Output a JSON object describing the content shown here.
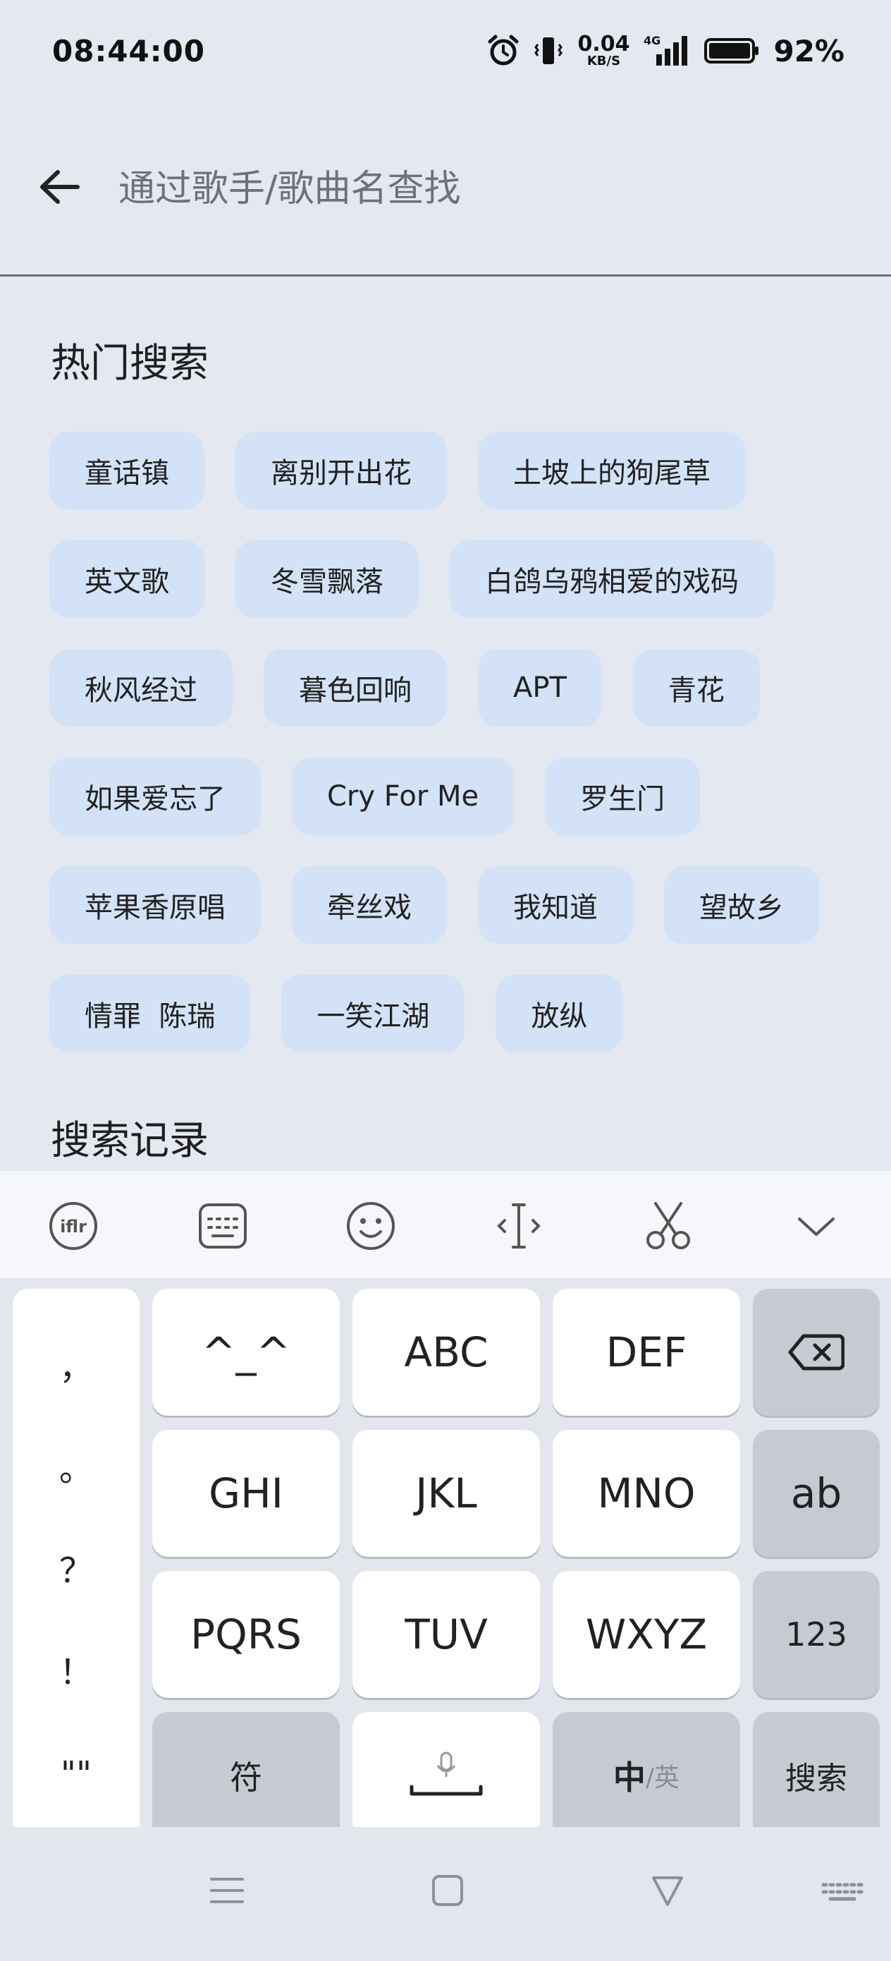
{
  "status_bar": {
    "time": "08:44:00",
    "net_speed_value": "0.04",
    "net_speed_unit": "KB/S",
    "network": "4G",
    "battery": "92%",
    "icons": [
      "alarm-icon",
      "vibrate-icon",
      "signal-icon",
      "battery-icon"
    ]
  },
  "search": {
    "placeholder": "通过歌手/歌曲名查找",
    "value": ""
  },
  "hot_search": {
    "title": "热门搜索",
    "items": [
      "童话镇",
      "离别开出花",
      "土坡上的狗尾草",
      "英文歌",
      "冬雪飘落",
      "白鸽乌鸦相爱的戏码",
      "秋风经过",
      "暮色回响",
      "APT",
      "青花",
      "如果爱忘了",
      "Cry For Me",
      "罗生门",
      "苹果香原唱",
      "牵丝戏",
      "我知道",
      "望故乡",
      "情罪  陈瑞",
      "一笑江湖",
      "放纵"
    ]
  },
  "search_history": {
    "title": "搜索记录"
  },
  "keyboard": {
    "toolbar_icons": [
      "ime-logo-icon",
      "keyboard-layout-icon",
      "emoji-icon",
      "cursor-icon",
      "scissors-icon",
      "collapse-icon"
    ],
    "punctuation": [
      "，",
      "。",
      "？",
      "！",
      "\"\""
    ],
    "keys": {
      "k1": "^_^",
      "k2": "ABC",
      "k3": "DEF",
      "k4": "GHI",
      "k5": "JKL",
      "k6": "MNO",
      "k7": "PQRS",
      "k8": "TUV",
      "k9": "WXYZ",
      "ab": "ab",
      "num": "123",
      "sym": "符",
      "lang_zh": "中",
      "lang_en": "/英",
      "search": "搜索"
    }
  },
  "nav_bar": {
    "icons": [
      "menu-icon",
      "home-icon",
      "back-icon",
      "keyboard-hide-icon"
    ]
  }
}
